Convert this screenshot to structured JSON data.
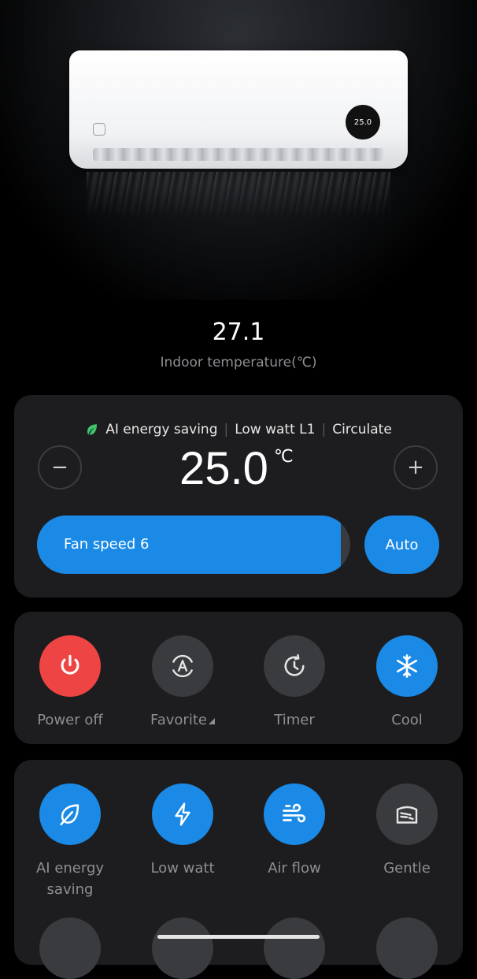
{
  "device_display": "25.0",
  "indoor": {
    "value": "27.1",
    "label": "Indoor temperature(℃)"
  },
  "control": {
    "modes": [
      "AI energy saving",
      "Low watt L1",
      "Circulate"
    ],
    "minus": "−",
    "plus": "+",
    "target_temp": "25.0",
    "unit": "℃",
    "fan_speed_label": "Fan speed 6",
    "fan_level_fraction": 0.97,
    "auto_label": "Auto"
  },
  "grid1": [
    {
      "label": "Power off",
      "icon": "power-icon",
      "color": "#ef4444"
    },
    {
      "label": "Favorite",
      "icon": "favorite-a-icon",
      "color": "#3a3b3f"
    },
    {
      "label": "Timer",
      "icon": "timer-icon",
      "color": "#3a3b3f"
    },
    {
      "label": "Cool",
      "icon": "snowflake-icon",
      "color": "#1a8ae6"
    }
  ],
  "grid2": [
    {
      "label": "AI energy saving",
      "icon": "leaf-icon",
      "color": "#1a8ae6"
    },
    {
      "label": "Low watt",
      "icon": "lightning-icon",
      "color": "#1a8ae6"
    },
    {
      "label": "Air flow",
      "icon": "wind-icon",
      "color": "#1a8ae6"
    },
    {
      "label": "Gentle",
      "icon": "gentle-breeze-icon",
      "color": "#3a3b3f"
    }
  ],
  "colors": {
    "accent": "#1a8ae6",
    "power": "#ef4444",
    "card": "#1d1d1f"
  }
}
